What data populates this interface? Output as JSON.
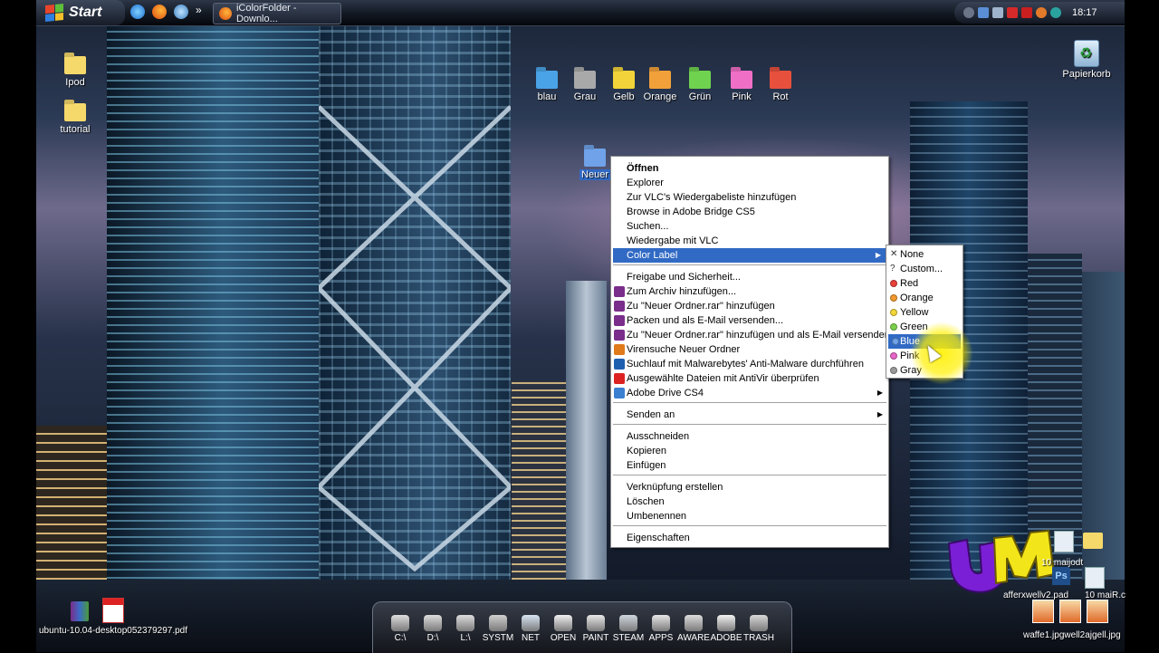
{
  "taskbar": {
    "start_label": "Start",
    "quicklaunch_more": "»",
    "task_button": "iColorFolder - Downlo...",
    "clock": "18:17",
    "tray_icons": [
      "chevron-left-icon",
      "network-icon",
      "monitor-icon",
      "ati-icon",
      "adobe-icon",
      "firefox-icon",
      "sync-icon"
    ]
  },
  "desktop_icons": {
    "ipod": "Ipod",
    "tutorial": "tutorial",
    "recycle": "Papierkorb",
    "pdf": "ubuntu-10.04-desktop052379297.pdf",
    "selected_folder": "Neuer",
    "color_folders": [
      {
        "label": "blau",
        "color": "#4aa3e6"
      },
      {
        "label": "Grau",
        "color": "#a9a9a9"
      },
      {
        "label": "Gelb",
        "color": "#f2d43a"
      },
      {
        "label": "Orange",
        "color": "#f2a13a"
      },
      {
        "label": "Grün",
        "color": "#6fd34f"
      },
      {
        "label": "Pink",
        "color": "#f06fc6"
      },
      {
        "label": "Rot",
        "color": "#e6503c"
      }
    ]
  },
  "context_menu": {
    "items": [
      "Öffnen",
      "Explorer",
      "Zur VLC's Wiedergabeliste hinzufügen",
      "Browse in Adobe Bridge CS5",
      "Suchen...",
      "Wiedergabe mit VLC",
      "Color Label",
      "Freigabe und Sicherheit...",
      "Zum Archiv hinzufügen...",
      "Zu \"Neuer Ordner.rar\" hinzufügen",
      "Packen und als E-Mail versenden...",
      "Zu \"Neuer Ordner.rar\" hinzufügen und als E-Mail versenden",
      "Virensuche Neuer Ordner",
      "Suchlauf mit Malwarebytes' Anti-Malware durchführen",
      "Ausgewählte Dateien mit AntiVir überprüfen",
      "Adobe Drive CS4",
      "Senden an",
      "Ausschneiden",
      "Kopieren",
      "Einfügen",
      "Verknüpfung erstellen",
      "Löschen",
      "Umbenennen",
      "Eigenschaften"
    ]
  },
  "color_submenu": {
    "items": [
      {
        "label": "None",
        "color": ""
      },
      {
        "label": "Custom...",
        "color": ""
      },
      {
        "label": "Red",
        "color": "#e8413a"
      },
      {
        "label": "Orange",
        "color": "#f29a2e"
      },
      {
        "label": "Yellow",
        "color": "#f2d63a"
      },
      {
        "label": "Green",
        "color": "#7bd04a"
      },
      {
        "label": "Blue",
        "color": "#6fa2e8"
      },
      {
        "label": "Pink",
        "color": "#e665c6"
      },
      {
        "label": "Gray",
        "color": "#9a9a9a"
      }
    ],
    "selected": "Blue"
  },
  "dock": {
    "items": [
      "C:\\",
      "D:\\",
      "L:\\",
      "SYSTM",
      "NET",
      "OPEN",
      "PAINT",
      "STEAM",
      "APPS",
      "AWARE",
      "ADOBE",
      "TRASH"
    ]
  },
  "bottom_right": {
    "label1": "10 maijodt",
    "label2": "afferxwellv2.pad",
    "label3": "10 maiR.c",
    "label4": "waffe1.jpgwell2ajgell.jpg"
  }
}
